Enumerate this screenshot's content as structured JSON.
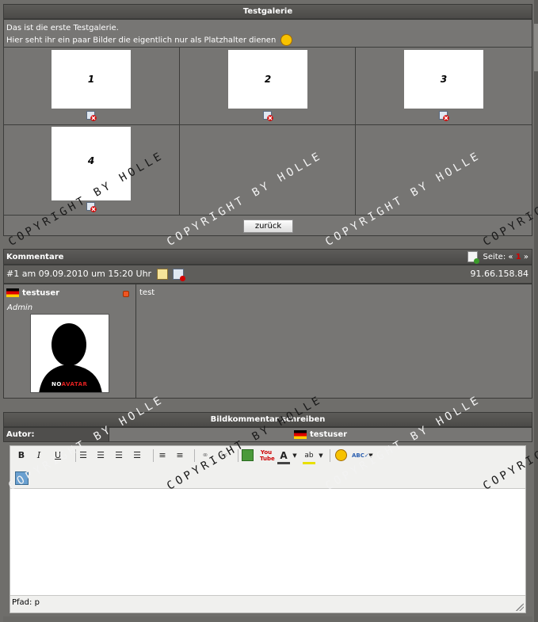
{
  "gallery": {
    "title": "Testgalerie",
    "description_line1": "Das ist die erste Testgalerie.",
    "description_line2": "Hier seht ihr ein paar Bilder die eigentlich nur als Platzhalter dienen",
    "images": [
      {
        "label": "1"
      },
      {
        "label": "2"
      },
      {
        "label": "3"
      },
      {
        "label": "4"
      }
    ],
    "back_button": "zurück"
  },
  "comments": {
    "title": "Kommentare",
    "pages_label": "Seite:",
    "page_prev": "«",
    "current_page": "1",
    "page_next": "»",
    "items": [
      {
        "header": "#1 am 09.09.2010 um 15:20 Uhr",
        "ip": "91.66.158.84",
        "username": "testuser",
        "role": "Admin",
        "avatar_text_a": "NO",
        "avatar_text_b": "AVATAR",
        "text": "test"
      }
    ]
  },
  "write_comment": {
    "title": "Bildkommentar schreiben",
    "author_label": "Autor:",
    "author_name": "testuser",
    "path_label": "Pfad: p",
    "editor_value": ""
  },
  "watermark": "COPYRIGHT BY HOLLE",
  "watermark_partial": "COPYRIG",
  "colors": {
    "page_bg": "#6f6e6b",
    "bar_bg": "#545351",
    "accent_red": "#d00000"
  }
}
